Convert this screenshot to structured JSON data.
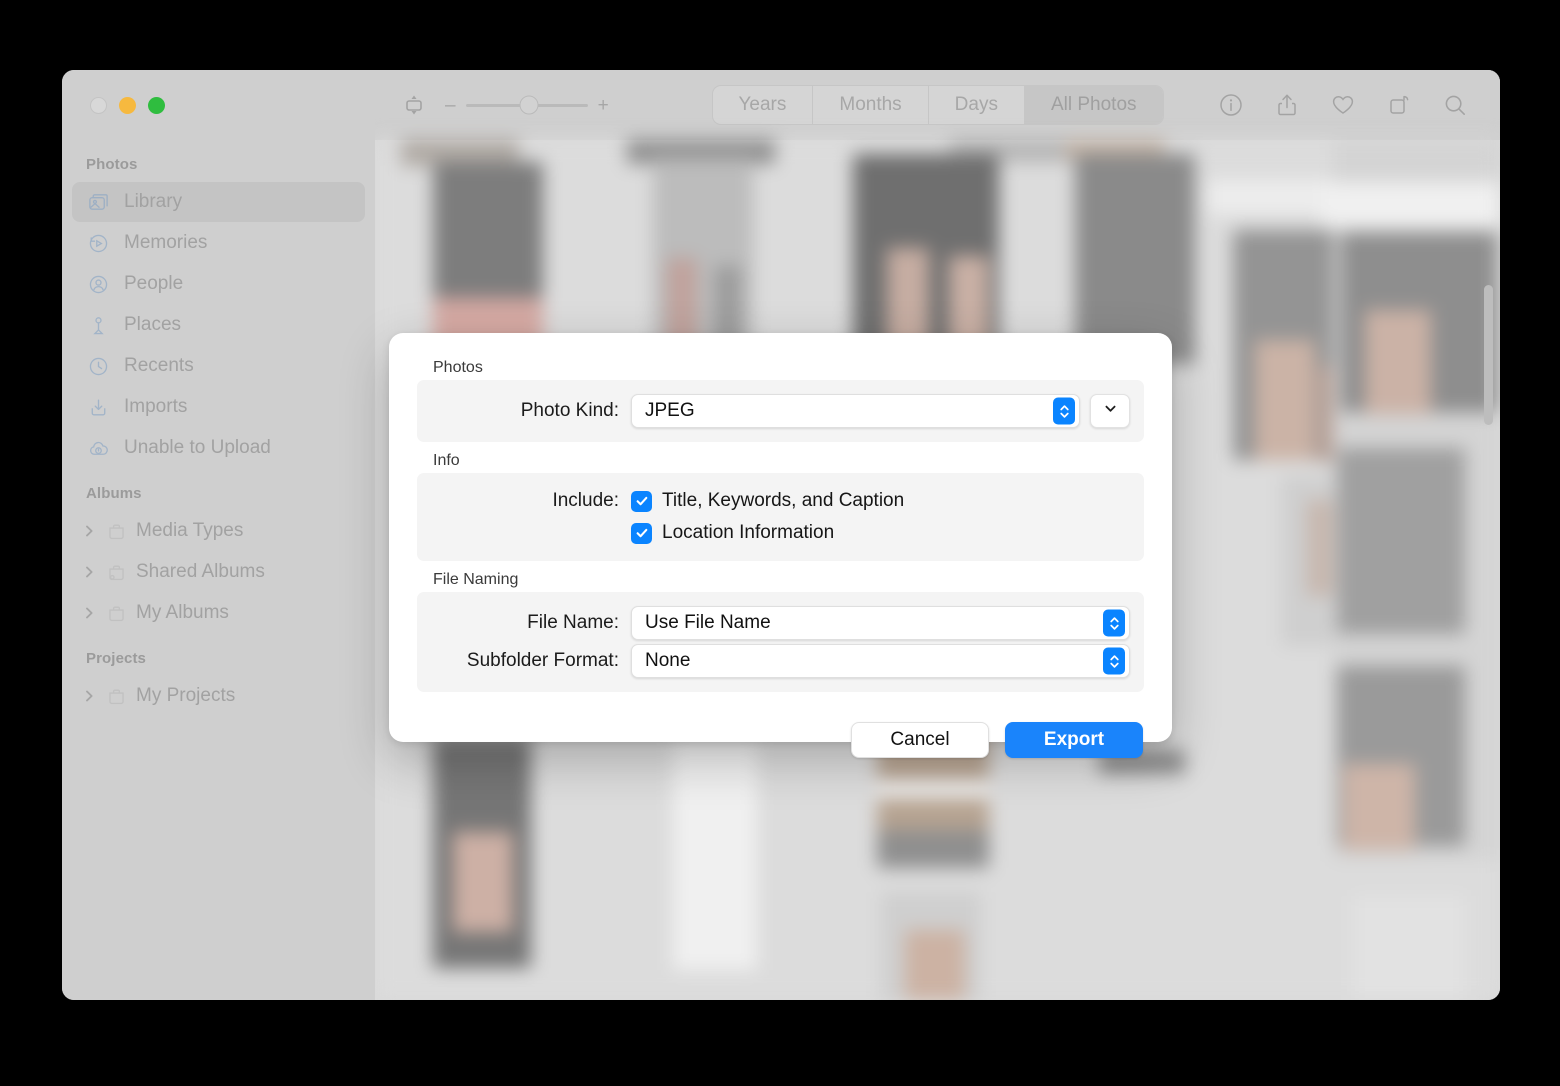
{
  "window": {
    "traffic_lights": [
      "close",
      "minimize",
      "maximize"
    ]
  },
  "sidebar": {
    "sections": [
      {
        "title": "Photos",
        "items": [
          {
            "label": "Library",
            "icon": "photos-library-icon",
            "selected": true,
            "disclosure": false
          },
          {
            "label": "Memories",
            "icon": "memories-icon",
            "selected": false,
            "disclosure": false
          },
          {
            "label": "People",
            "icon": "people-icon",
            "selected": false,
            "disclosure": false
          },
          {
            "label": "Places",
            "icon": "places-pin-icon",
            "selected": false,
            "disclosure": false
          },
          {
            "label": "Recents",
            "icon": "recents-clock-icon",
            "selected": false,
            "disclosure": false
          },
          {
            "label": "Imports",
            "icon": "imports-icon",
            "selected": false,
            "disclosure": false
          },
          {
            "label": "Unable to Upload",
            "icon": "cloud-warning-icon",
            "selected": false,
            "disclosure": false
          }
        ]
      },
      {
        "title": "Albums",
        "items": [
          {
            "label": "Media Types",
            "icon": "album-folder-icon",
            "selected": false,
            "disclosure": true
          },
          {
            "label": "Shared Albums",
            "icon": "shared-album-folder-icon",
            "selected": false,
            "disclosure": true
          },
          {
            "label": "My Albums",
            "icon": "album-folder-icon",
            "selected": false,
            "disclosure": true
          }
        ]
      },
      {
        "title": "Projects",
        "items": [
          {
            "label": "My Projects",
            "icon": "album-folder-icon",
            "selected": false,
            "disclosure": true
          }
        ]
      }
    ]
  },
  "toolbar": {
    "aspect_button_icon": "aspect-ratio-icon",
    "zoom_out_label": "–",
    "zoom_in_label": "+",
    "zoom_value_percent": 52,
    "segments": [
      {
        "label": "Years",
        "active": false
      },
      {
        "label": "Months",
        "active": false
      },
      {
        "label": "Days",
        "active": false
      },
      {
        "label": "All Photos",
        "active": true
      }
    ],
    "right_icons": [
      "info-icon",
      "share-icon",
      "favorite-heart-icon",
      "rotate-icon",
      "search-icon"
    ]
  },
  "dialog": {
    "groups": [
      {
        "title": "Photos",
        "rows": [
          {
            "type": "popup",
            "label": "Photo Kind:",
            "value": "JPEG",
            "has_extra_chevron": true
          }
        ]
      },
      {
        "title": "Info",
        "rows": [
          {
            "type": "checkbox",
            "label": "Include:",
            "value": "Title, Keywords, and Caption",
            "checked": true
          },
          {
            "type": "checkbox",
            "label": "",
            "value": "Location Information",
            "checked": true
          }
        ]
      },
      {
        "title": "File Naming",
        "rows": [
          {
            "type": "popup",
            "label": "File Name:",
            "value": "Use File Name",
            "has_extra_chevron": false
          },
          {
            "type": "popup",
            "label": "Subfolder Format:",
            "value": "None",
            "has_extra_chevron": false
          }
        ]
      }
    ],
    "actions": {
      "cancel_label": "Cancel",
      "export_label": "Export"
    }
  },
  "colors": {
    "accent_blue": "#0a84ff",
    "primary_button_blue": "#1a84fb",
    "window_chrome": "#cfcfcf",
    "content_background": "#d9d9d9",
    "dialog_background": "#ffffff",
    "group_box": "#f4f4f4"
  }
}
